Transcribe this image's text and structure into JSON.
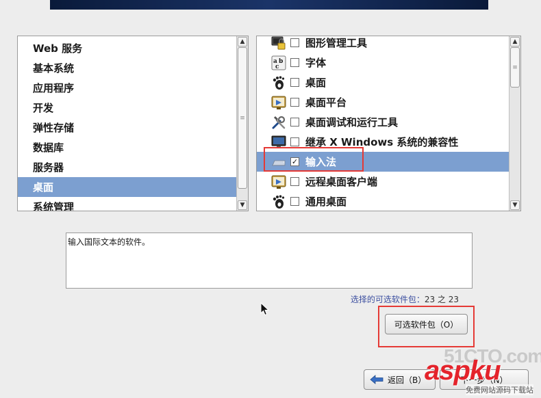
{
  "categories": [
    {
      "label": "Web 服务",
      "selected": false
    },
    {
      "label": "基本系统",
      "selected": false
    },
    {
      "label": "应用程序",
      "selected": false
    },
    {
      "label": "开发",
      "selected": false
    },
    {
      "label": "弹性存储",
      "selected": false
    },
    {
      "label": "数据库",
      "selected": false
    },
    {
      "label": "服务器",
      "selected": false
    },
    {
      "label": "桌面",
      "selected": true
    },
    {
      "label": "系统管理",
      "selected": false
    }
  ],
  "packages": [
    {
      "label": "图形管理工具",
      "icon": "lock-monitor-icon",
      "checked": false,
      "selected": false
    },
    {
      "label": "字体",
      "icon": "font-icon",
      "checked": false,
      "selected": false
    },
    {
      "label": "桌面",
      "icon": "gnome-foot-icon",
      "checked": false,
      "selected": false
    },
    {
      "label": "桌面平台",
      "icon": "desktop-platform-icon",
      "checked": false,
      "selected": false
    },
    {
      "label": "桌面调试和运行工具",
      "icon": "tools-icon",
      "checked": false,
      "selected": false
    },
    {
      "label": "继承 X Windows 系统的兼容性",
      "icon": "monitor-icon",
      "checked": false,
      "selected": false
    },
    {
      "label": "输入法",
      "icon": "keyboard-icon",
      "checked": true,
      "selected": true
    },
    {
      "label": "远程桌面客户端",
      "icon": "desktop-platform-icon",
      "checked": false,
      "selected": false
    },
    {
      "label": "通用桌面",
      "icon": "gnome-foot-icon",
      "checked": false,
      "selected": false
    }
  ],
  "description": "输入国际文本的软件。",
  "count": {
    "label": "选择的可选软件包：",
    "value": "23 之 23"
  },
  "buttons": {
    "optional": "可选软件包（O）",
    "back": "返回（B）",
    "next": "下一步（N）"
  },
  "watermark": {
    "site": "51CTO.com",
    "brand": "aspku",
    "tagline": "免费网站源码下载站"
  },
  "colors": {
    "selection": "#7c9fd0",
    "highlight": "#e53935"
  }
}
